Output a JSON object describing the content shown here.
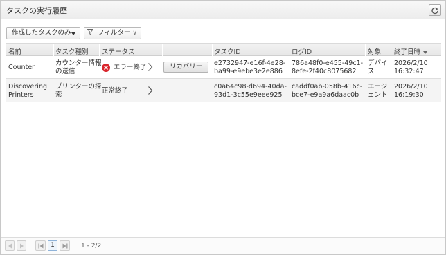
{
  "header": {
    "title": "タスクの実行履歴",
    "refresh_icon": "refresh-icon"
  },
  "toolbar": {
    "scope_label": "作成したタスクのみ",
    "filter_label": "フィルター",
    "filter_icon": "funnel-icon"
  },
  "table": {
    "columns": [
      "名前",
      "タスク種別",
      "ステータス",
      "タスクID",
      "ログID",
      "対象",
      "終了日時"
    ],
    "sort_column": "終了日時",
    "rows": [
      {
        "name": "Counter",
        "type_line1": "カウンター情報",
        "type_line2": "の送信",
        "status": "エラー終了",
        "status_icon": "error-icon",
        "action": "リカバリー",
        "task_id_line1": "e2732947-e16f-4e28-",
        "task_id_line2": "ba99-e9ebe3e2e886",
        "log_id_line1": "786a48f0-e455-49c1-",
        "log_id_line2": "8efe-2f40c8075682",
        "target_line1": "デバイ",
        "target_line2": "ス",
        "end_date": "2026/2/10",
        "end_time": "16:32:47"
      },
      {
        "name_line1": "Discovering",
        "name_line2": "Printers",
        "type_line1": "プリンターの探",
        "type_line2": "索",
        "status": "正常終了",
        "task_id_line1": "c0a64c98-d694-40da-",
        "task_id_line2": "93d1-3c55e9eee925",
        "log_id_line1": "caddf0ab-058b-416c-",
        "log_id_line2": "bce7-e9a9a6daac0b",
        "target_line1": "エージ",
        "target_line2": "ェント",
        "end_date": "2026/2/10",
        "end_time": "16:19:30"
      }
    ]
  },
  "pagination": {
    "current_page": "1",
    "range_text": "1 - 2/2"
  },
  "colors": {
    "error": "#d9252c",
    "header_bg": "#ececec",
    "row_alt": "#f4f4f4"
  }
}
